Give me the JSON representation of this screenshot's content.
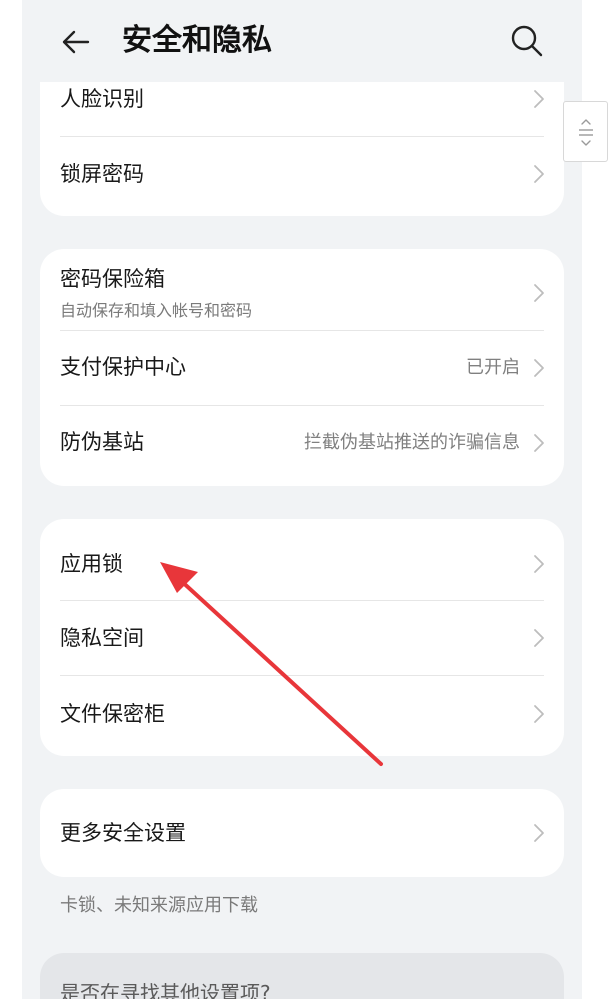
{
  "header": {
    "title": "安全和隐私"
  },
  "card1": {
    "items": [
      {
        "title": "人脸识别"
      },
      {
        "title": "锁屏密码"
      }
    ]
  },
  "card2": {
    "items": [
      {
        "title": "密码保险箱",
        "subtitle": "自动保存和填入帐号和密码"
      },
      {
        "title": "支付保护中心",
        "value": "已开启"
      },
      {
        "title": "防伪基站",
        "value": "拦截伪基站推送的诈骗信息"
      }
    ]
  },
  "card3": {
    "items": [
      {
        "title": "应用锁"
      },
      {
        "title": "隐私空间"
      },
      {
        "title": "文件保密柜"
      }
    ]
  },
  "card4": {
    "items": [
      {
        "title": "更多安全设置"
      }
    ],
    "note": "卡锁、未知来源应用下载"
  },
  "hint": {
    "text": "是否在寻找其他设置项?"
  },
  "colors": {
    "background": "#f1f3f5",
    "card": "#ffffff",
    "annotation": "#e8363a"
  },
  "icons": {
    "back": "arrow-left-icon",
    "search": "search-icon",
    "chevron": "chevron-right-icon",
    "handle": "drag-handle-icon"
  }
}
